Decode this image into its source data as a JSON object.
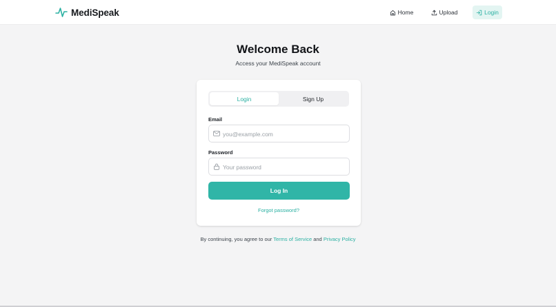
{
  "header": {
    "brand": "MediSpeak",
    "nav": [
      {
        "label": "Home",
        "icon": "home-icon"
      },
      {
        "label": "Upload",
        "icon": "upload-icon"
      },
      {
        "label": "Login",
        "icon": "login-icon"
      }
    ]
  },
  "main": {
    "title": "Welcome Back",
    "subtitle": "Access your MediSpeak account"
  },
  "form": {
    "tabs": {
      "login": "Login",
      "signup": "Sign Up"
    },
    "email_label": "Email",
    "email_placeholder": "you@example.com",
    "email_icon": "mail-icon",
    "password_label": "Password",
    "password_placeholder": "Your password",
    "password_icon": "lock-icon",
    "submit": "Log In",
    "forgot": "Forgot password?"
  },
  "footer": {
    "prefix": "By continuing, you agree to our",
    "terms": "Terms of Service",
    "and": "and",
    "privacy": "Privacy Policy"
  },
  "colors": {
    "accent": "#2ab0a2",
    "accent_button": "#30b5a7",
    "background": "#f4f4f5"
  }
}
